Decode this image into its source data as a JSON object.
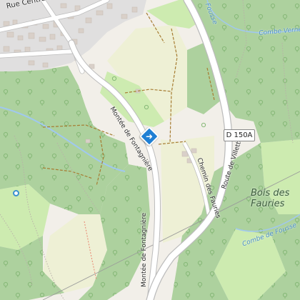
{
  "map": {
    "labels": {
      "rue_centrale": "Rue Centrale",
      "montee_fontagniere_upper": "Montée de Fontagnière",
      "montee_fontagniere_lower": "Montée de Fontagnière",
      "chemin_des_fauries": "Chemin des Fauries",
      "route_de_villette": "Route de Villette",
      "road_ref": "D 150A",
      "stream_fousse_top": "Fousse",
      "stream_combe_vernet": "Combe Verne",
      "stream_combe_fousse": "Combe de Fousse",
      "area_bois_line1": "Bois des",
      "area_bois_line2": "Fauries"
    },
    "colors": {
      "background": "#f2efe9",
      "forest": "#add19e",
      "meadow": "#cdebb0",
      "farmland": "#eef0d5",
      "built_up": "#e0dfdf",
      "building": "#d9d0c9",
      "road": "#ffffff",
      "road_casing": "#bcbcbc",
      "track": "#a67c32",
      "path": "#e8846f",
      "stream": "#a0c8f0",
      "marker": "#1f7fd4"
    },
    "icons": {
      "marker": "directions-diamond-icon",
      "poi": "circle-poi-icon",
      "trees": "tree-icon"
    }
  }
}
